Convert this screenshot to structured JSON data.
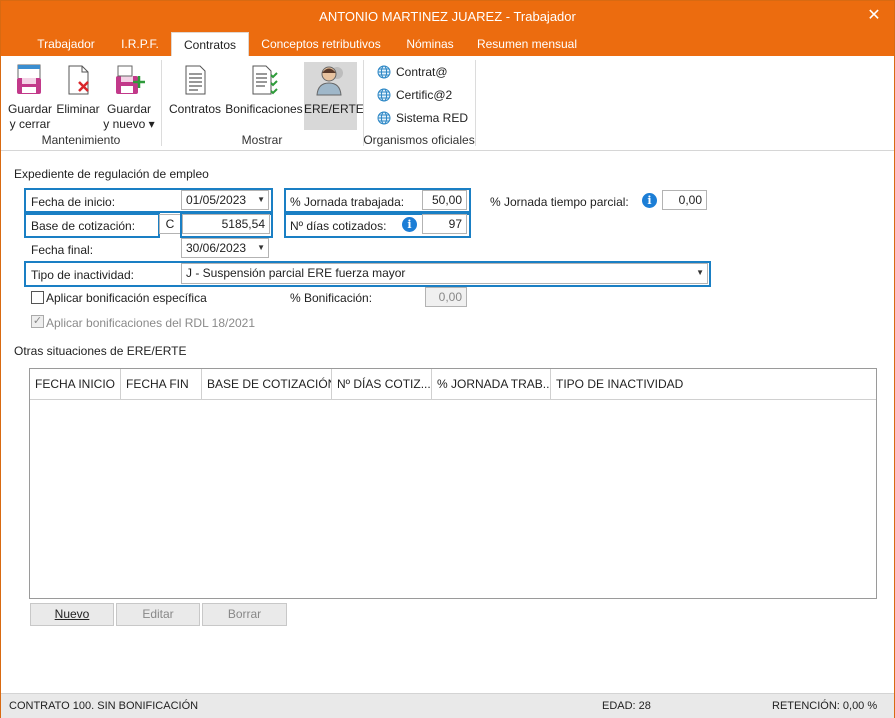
{
  "window": {
    "title": "ANTONIO MARTINEZ JUAREZ - Trabajador"
  },
  "tabs": [
    {
      "label": "Trabajador"
    },
    {
      "label": "I.R.P.F."
    },
    {
      "label": "Contratos"
    },
    {
      "label": "Conceptos retributivos"
    },
    {
      "label": "Nóminas"
    },
    {
      "label": "Resumen mensual"
    }
  ],
  "ribbon": {
    "mantenimiento": {
      "label": "Mantenimiento",
      "guardar_cerrar_1": "Guardar",
      "guardar_cerrar_2": "y cerrar",
      "eliminar": "Eliminar",
      "guardar_nuevo_1": "Guardar",
      "guardar_nuevo_2": "y nuevo ▾"
    },
    "mostrar": {
      "label": "Mostrar",
      "contratos": "Contratos",
      "bonificaciones": "Bonificaciones",
      "ere_erte": "ERE/ERTE"
    },
    "organismos": {
      "label": "Organismos oficiales",
      "contrata": "Contrat@",
      "certifica": "Certific@2",
      "sistema_red": "Sistema RED"
    }
  },
  "form": {
    "section_title": "Expediente de regulación de empleo",
    "fecha_inicio_label": "Fecha de inicio:",
    "fecha_inicio_value": "01/05/2023",
    "jornada_label": "% Jornada trabajada:",
    "jornada_value": "50,00",
    "jornada_parcial_label": "% Jornada tiempo parcial:",
    "jornada_parcial_value": "0,00",
    "base_label": "Base de cotización:",
    "base_code": "C",
    "base_value": "5185,54",
    "dias_label": "Nº días cotizados:",
    "dias_value": "97",
    "fecha_final_label": "Fecha final:",
    "fecha_final_value": "30/06/2023",
    "tipo_label": "Tipo de inactividad:",
    "tipo_value": "J - Suspensión parcial ERE fuerza mayor",
    "bonif_especifica_label": "Aplicar bonificación específica",
    "bonif_pct_label": "% Bonificación:",
    "bonif_pct_value": "0,00",
    "bonif_rdl_label": "Aplicar bonificaciones del RDL 18/2021"
  },
  "otras": {
    "title": "Otras situaciones de ERE/ERTE",
    "columns": [
      "FECHA INICIO",
      "FECHA FIN",
      "BASE DE COTIZACIÓN",
      "Nº DÍAS COTIZ...",
      "% JORNADA TRAB...",
      "TIPO DE INACTIVIDAD"
    ],
    "rows": []
  },
  "buttons": {
    "nuevo": "Nuevo",
    "editar": "Editar",
    "borrar": "Borrar"
  },
  "status": {
    "contrato": "CONTRATO 100.  SIN BONIFICACIÓN",
    "edad": "EDAD: 28",
    "retencion": "RETENCIÓN: 0,00 %"
  },
  "colors": {
    "accent": "#ec6c0f",
    "highlight": "#1a7fc4",
    "info": "#1c7ed6"
  }
}
